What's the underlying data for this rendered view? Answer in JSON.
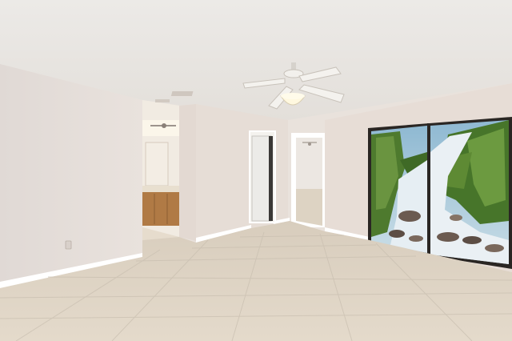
{
  "scene": {
    "kind": "photo",
    "colors": {
      "ceiling": "#ebe8e4",
      "wall_left": "#e2dbd6",
      "wall_right": "#e7ddd6",
      "floor": "#ddd3c4",
      "baseboard": "#ffffff",
      "door_white": "#f4f2ee",
      "cabinet": "#b07a45",
      "mural_sky": "#9fc4d8",
      "mural_foliage": "#4e7a2e",
      "mural_water": "#e8eef2",
      "mural_rock": "#6b5a50",
      "frame": "#2a2623"
    },
    "icons": [
      "ceiling-fan-icon",
      "light-fixture-icon",
      "outlet-icon"
    ]
  }
}
